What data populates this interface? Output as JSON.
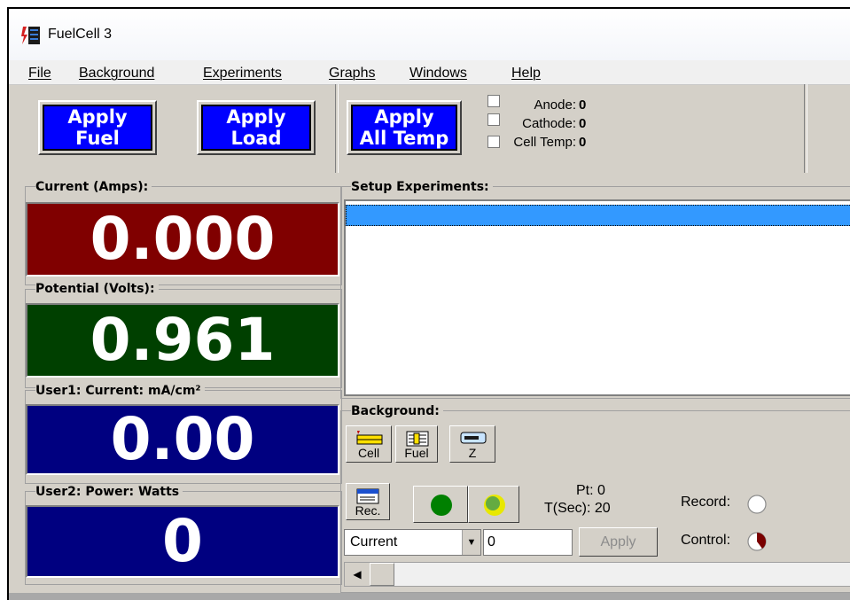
{
  "window": {
    "title": "FuelCell 3"
  },
  "menu": [
    "File",
    "Background",
    "Experiments",
    "Graphs",
    "Windows",
    "Help"
  ],
  "toolbar": {
    "apply_fuel": [
      "Apply",
      "Fuel"
    ],
    "apply_load": [
      "Apply",
      "Load"
    ],
    "apply_all_temp": [
      "Apply",
      "All Temp"
    ],
    "temps": [
      {
        "label": "Anode:",
        "value": "0"
      },
      {
        "label": "Cathode:",
        "value": "0"
      },
      {
        "label": "Cell Temp:",
        "value": "0"
      }
    ]
  },
  "readouts": [
    {
      "label": "Current (Amps):",
      "value": "0.000",
      "color": "#800000"
    },
    {
      "label": "Potential (Volts):",
      "value": "0.961",
      "color": "#004000"
    },
    {
      "label": "User1: Current: mA/cm²",
      "value": "0.00",
      "color": "#000080"
    },
    {
      "label": "User2: Power: Watts",
      "value": "0",
      "color": "#000080"
    }
  ],
  "setup": {
    "label": "Setup Experiments:"
  },
  "background": {
    "label": "Background:",
    "buttons": {
      "cell": "Cell",
      "fuel": "Fuel",
      "z": "Z",
      "rec": "Rec."
    },
    "pt": "Pt: 0",
    "tsec": "T(Sec): 20",
    "record_label": "Record:",
    "control_label": "Control:",
    "mode_select": "Current",
    "value_input": "0",
    "apply_label": "Apply"
  }
}
